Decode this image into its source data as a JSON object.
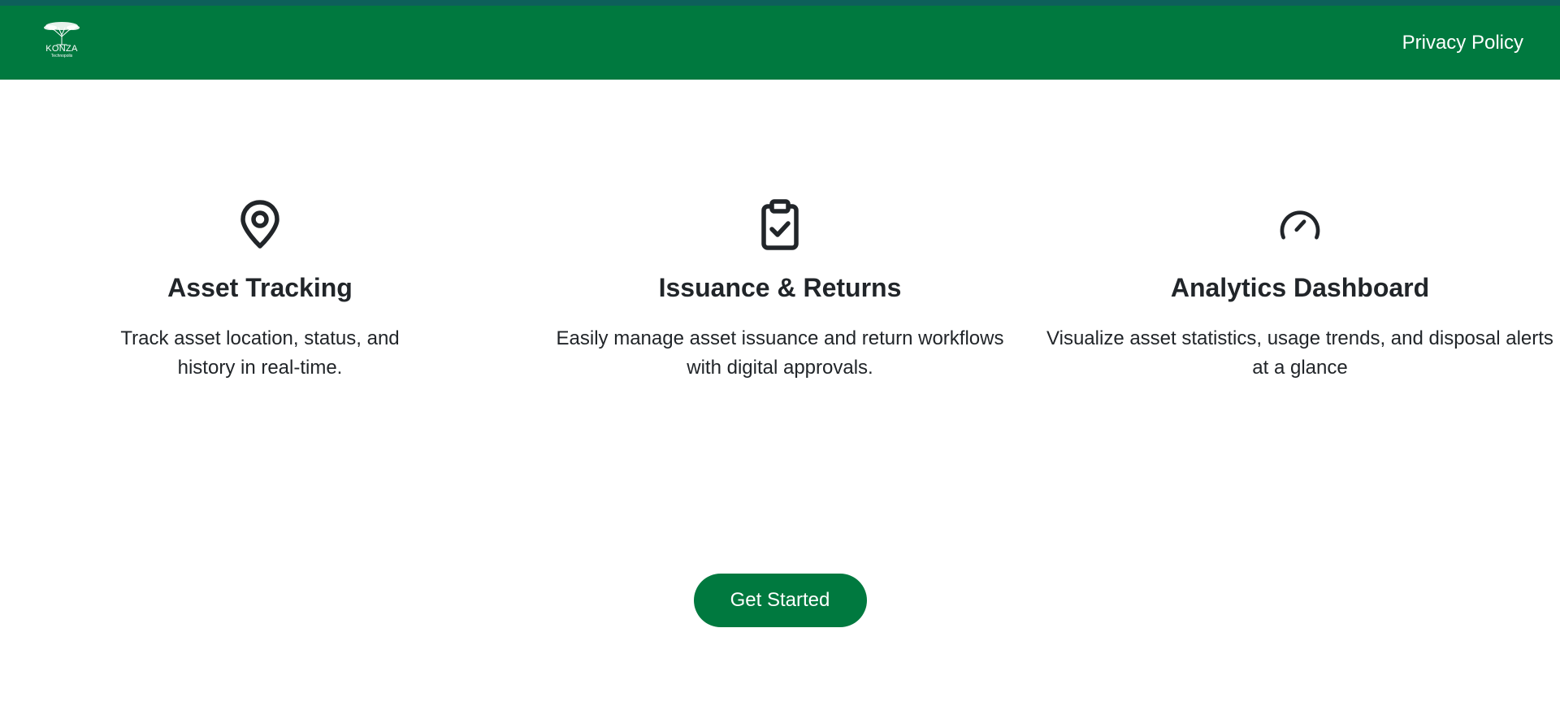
{
  "brand": {
    "logo_text": "KONZA",
    "logo_subtext": "Technopolis"
  },
  "nav": {
    "privacy_link": "Privacy Policy"
  },
  "features": [
    {
      "icon": "map-pin-icon",
      "title": "Asset Tracking",
      "description": "Track asset location, status, and history in real-time."
    },
    {
      "icon": "clipboard-check-icon",
      "title": "Issuance & Returns",
      "description": "Easily manage asset issuance and return workflows with digital approvals."
    },
    {
      "icon": "speedometer-icon",
      "title": "Analytics Dashboard",
      "description": "Visualize asset statistics, usage trends, and disposal alerts at a glance"
    }
  ],
  "cta": {
    "label": "Get Started"
  },
  "colors": {
    "primary_green": "#00793f",
    "top_strip": "#0d5f5a",
    "text": "#212529"
  }
}
